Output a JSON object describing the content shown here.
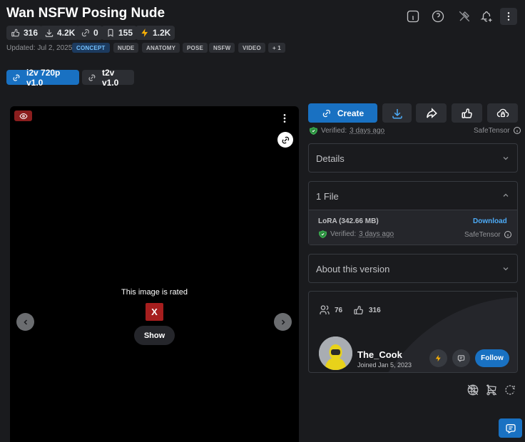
{
  "header": {
    "title": "Wan NSFW Posing Nude",
    "stats": {
      "likes": "316",
      "downloads": "4.2K",
      "links": "0",
      "bookmarks": "155",
      "buzz": "1.2K"
    },
    "updated": "Updated: Jul 2, 2025",
    "tags": [
      "CONCEPT",
      "NUDE",
      "ANATOMY",
      "POSE",
      "NSFW",
      "VIDEO",
      "+ 1"
    ]
  },
  "versions": [
    "i2v 720p v1.0",
    "t2v v1.0"
  ],
  "media": {
    "rated_text": "This image is rated",
    "rating": "X",
    "show_label": "Show"
  },
  "actions": {
    "create_label": "Create",
    "verified_prefix": "Verified:",
    "verified_time": "3 days ago",
    "format": "SafeTensor"
  },
  "details": {
    "label": "Details"
  },
  "files": {
    "label": "1 File",
    "file_name": "LoRA (342.66 MB)",
    "download_label": "Download",
    "verified_prefix": "Verified:",
    "verified_time": "3 days ago",
    "format": "SafeTensor"
  },
  "about": {
    "label": "About this version"
  },
  "creator": {
    "followers": "76",
    "likes": "316",
    "name": "The_Cook",
    "joined": "Joined Jan 5, 2023",
    "follow_label": "Follow"
  },
  "colors": {
    "accent": "#1971c2",
    "verified": "#40c057",
    "rating_badge": "#a61e1e"
  },
  "icons": [
    "info-icon",
    "help-icon",
    "hammer-icon",
    "bell-plus-icon",
    "dots-vertical-icon",
    "link-icon",
    "eye-icon",
    "download-icon",
    "share-icon",
    "thumb-up-icon",
    "cloud-lock-icon",
    "shield-check-icon",
    "chevron-down-icon",
    "chevron-up-icon",
    "users-icon",
    "bolt-icon",
    "message-icon",
    "world-off-icon",
    "cart-off-icon",
    "rotate-icon",
    "chat-icon"
  ]
}
